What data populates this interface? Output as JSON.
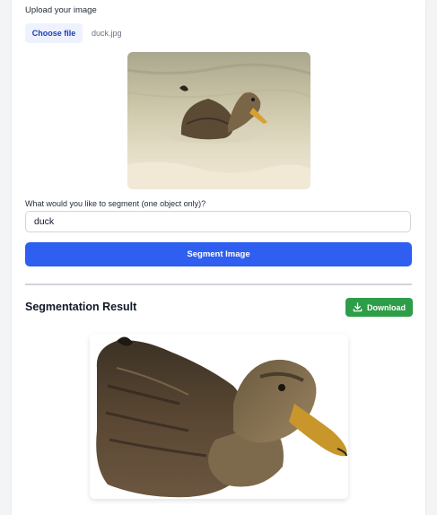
{
  "upload": {
    "label": "Upload your image",
    "choose_label": "Choose file",
    "file_name": "duck.jpg"
  },
  "prompt": {
    "label": "What would you like to segment (one object only)?",
    "value": "duck"
  },
  "actions": {
    "segment_label": "Segment Image"
  },
  "result": {
    "title": "Segmentation Result",
    "download_label": "Download"
  },
  "colors": {
    "primary": "#2f5ff1",
    "download": "#2e9d47",
    "choose_bg": "#eef2ff",
    "choose_text": "#1e40af"
  },
  "icons": {
    "download": "download-icon"
  }
}
